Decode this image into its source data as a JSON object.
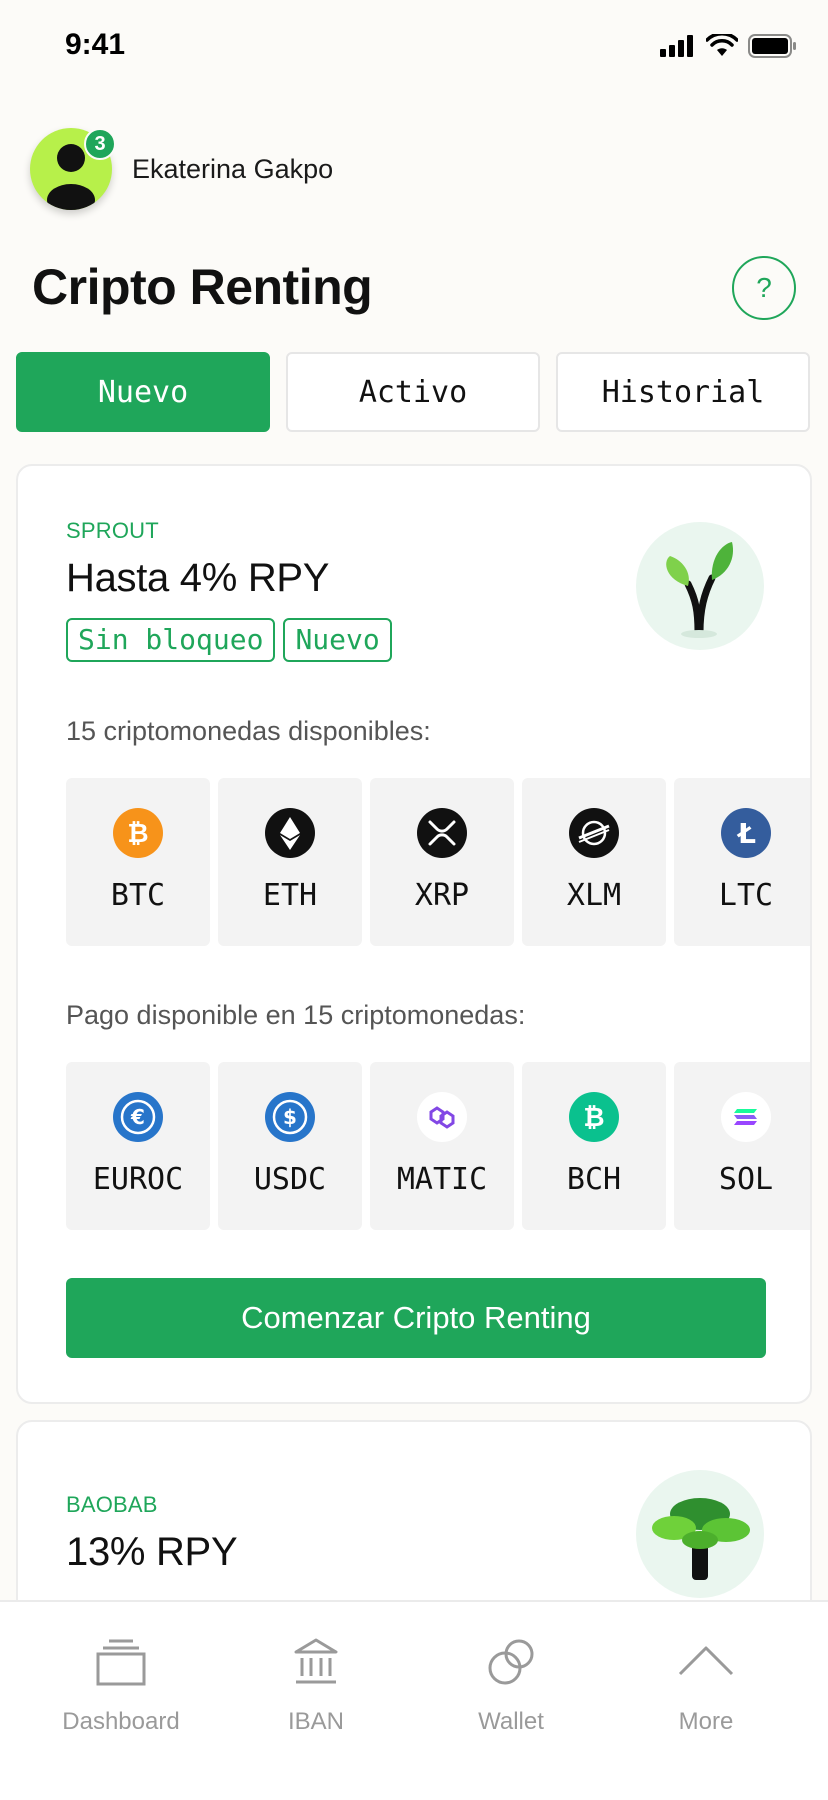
{
  "status_bar": {
    "time": "9:41"
  },
  "profile": {
    "name": "Ekaterina Gakpo",
    "notification_count": "3"
  },
  "page": {
    "title": "Cripto Renting",
    "help_label": "?"
  },
  "tabs": [
    {
      "label": "Nuevo",
      "active": true
    },
    {
      "label": "Activo",
      "active": false
    },
    {
      "label": "Historial",
      "active": false
    }
  ],
  "plans": [
    {
      "kicker": "SPROUT",
      "title": "Hasta 4% RPY",
      "tags": [
        "Sin bloqueo",
        "Nuevo"
      ],
      "available_label": "15 criptomonedas disponibles:",
      "available_coins": [
        {
          "symbol": "BTC",
          "icon": "bitcoin-icon",
          "color": "#f7931a"
        },
        {
          "symbol": "ETH",
          "icon": "ethereum-icon",
          "color": "#111111"
        },
        {
          "symbol": "XRP",
          "icon": "xrp-icon",
          "color": "#111111"
        },
        {
          "symbol": "XLM",
          "icon": "stellar-icon",
          "color": "#111111"
        },
        {
          "symbol": "LTC",
          "icon": "litecoin-icon",
          "color": "#345d9d"
        }
      ],
      "payout_label": "Pago disponible en 15 criptomonedas:",
      "payout_coins": [
        {
          "symbol": "EUROC",
          "icon": "euroc-icon",
          "color": "#2775ca"
        },
        {
          "symbol": "USDC",
          "icon": "usdc-icon",
          "color": "#2775ca"
        },
        {
          "symbol": "MATIC",
          "icon": "polygon-icon",
          "color": "#8247e5"
        },
        {
          "symbol": "BCH",
          "icon": "bitcoin-cash-icon",
          "color": "#0ac18e"
        },
        {
          "symbol": "SOL",
          "icon": "solana-icon",
          "color": "#9945ff"
        }
      ],
      "cta_label": "Comenzar Cripto Renting"
    },
    {
      "kicker": "BAOBAB",
      "title": "13% RPY"
    }
  ],
  "bottom_nav": [
    {
      "label": "Dashboard",
      "icon": "dashboard-icon"
    },
    {
      "label": "IBAN",
      "icon": "bank-icon"
    },
    {
      "label": "Wallet",
      "icon": "wallet-icon"
    },
    {
      "label": "More",
      "icon": "chevron-up-icon"
    }
  ],
  "colors": {
    "accent": "#1fa65a",
    "background": "#fcfbf8"
  }
}
